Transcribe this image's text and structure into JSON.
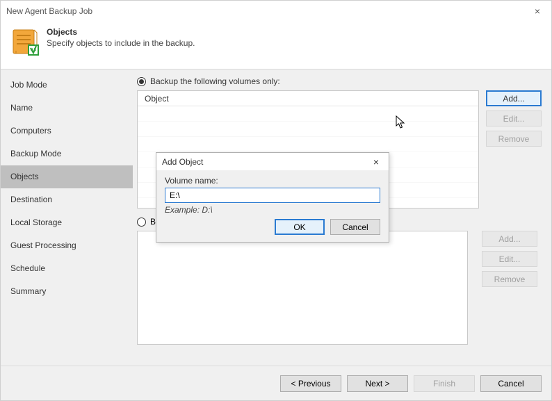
{
  "window": {
    "title": "New Agent Backup Job",
    "close_glyph": "×"
  },
  "header": {
    "title": "Objects",
    "subtitle": "Specify objects to include in the backup."
  },
  "sidebar": {
    "steps": [
      {
        "label": "Job Mode"
      },
      {
        "label": "Name"
      },
      {
        "label": "Computers"
      },
      {
        "label": "Backup Mode"
      },
      {
        "label": "Objects",
        "active": true
      },
      {
        "label": "Destination"
      },
      {
        "label": "Local Storage"
      },
      {
        "label": "Guest Processing"
      },
      {
        "label": "Schedule"
      },
      {
        "label": "Summary"
      }
    ]
  },
  "content": {
    "radio1_label": "Backup the following volumes only:",
    "col_header": "Object",
    "add_label": "Add...",
    "edit_label": "Edit...",
    "remove_label": "Remove",
    "radio2_label_visible": "B",
    "add2_label": "Add...",
    "edit2_label": "Edit...",
    "remove2_label": "Remove"
  },
  "modal": {
    "title": "Add Object",
    "close_glyph": "×",
    "field_label": "Volume name:",
    "value": "E:\\",
    "example": "Example: D:\\",
    "ok": "OK",
    "cancel": "Cancel"
  },
  "footer": {
    "previous": "< Previous",
    "next": "Next >",
    "finish": "Finish",
    "cancel": "Cancel"
  }
}
